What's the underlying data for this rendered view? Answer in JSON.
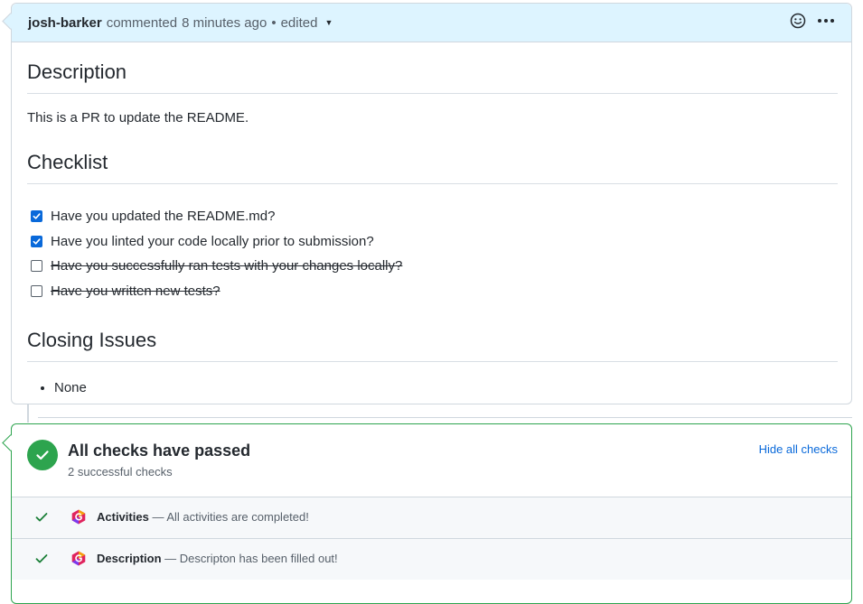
{
  "comment": {
    "author": "josh-barker",
    "action": "commented",
    "time": "8 minutes ago",
    "separator": "•",
    "edited": "edited",
    "sections": {
      "description": {
        "heading": "Description",
        "text": "This is a PR to update the README."
      },
      "checklist": {
        "heading": "Checklist",
        "items": [
          {
            "label": "Have you updated the README.md?",
            "checked": true,
            "struck": false
          },
          {
            "label": "Have you linted your code locally prior to submission?",
            "checked": true,
            "struck": false
          },
          {
            "label": "Have you successfully ran tests with your changes locally?",
            "checked": false,
            "struck": true
          },
          {
            "label": "Have you written new tests?",
            "checked": false,
            "struck": true
          }
        ]
      },
      "closing": {
        "heading": "Closing Issues",
        "items": [
          "None"
        ]
      }
    },
    "icons": {
      "emoji": "smiley-icon",
      "more": "kebab-horizontal-icon"
    }
  },
  "checks": {
    "title": "All checks have passed",
    "subtitle": "2 successful checks",
    "hide_link": "Hide all checks",
    "accent": "#2da44e",
    "rows": [
      {
        "name": "Activities",
        "dash": "—",
        "message": "All activities are completed!"
      },
      {
        "name": "Description",
        "dash": "—",
        "message": "Descripton has been filled out!"
      }
    ]
  },
  "colors": {
    "header_bg": "#ddf4ff",
    "border": "#d0d7de",
    "checkbox_blue": "#0969da",
    "link": "#0969da",
    "success": "#2da44e",
    "row_bg": "#f6f8fa"
  }
}
